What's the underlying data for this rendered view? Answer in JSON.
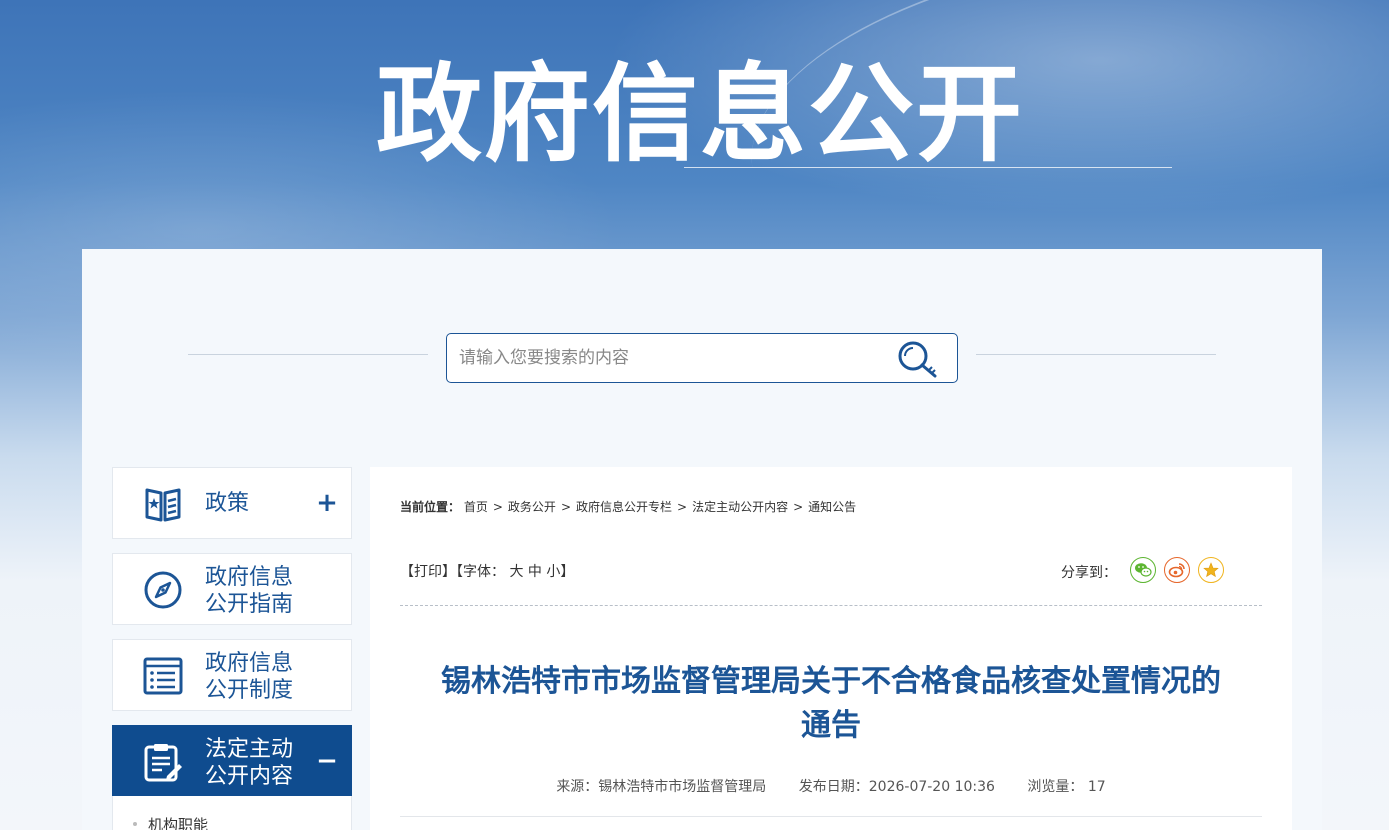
{
  "header": {
    "title": "政府信息公开"
  },
  "search": {
    "placeholder": "请输入您要搜索的内容"
  },
  "sidebar": {
    "items": [
      {
        "line1": "政策",
        "line2": "",
        "toggle": "+"
      },
      {
        "line1": "政府信息",
        "line2": "公开指南",
        "toggle": ""
      },
      {
        "line1": "政府信息",
        "line2": "公开制度",
        "toggle": ""
      },
      {
        "line1": "法定主动",
        "line2": "公开内容",
        "toggle": "−"
      }
    ],
    "sub_items": [
      "机构职能"
    ]
  },
  "breadcrumb": {
    "label": "当前位置：",
    "items": [
      "首页",
      "政务公开",
      "政府信息公开专栏",
      "法定主动公开内容",
      "通知公告"
    ],
    "separator": ">"
  },
  "toolbar": {
    "print": "【打印】",
    "font_open": "【字体：",
    "font_large": "大",
    "font_medium": "中",
    "font_small": "小",
    "font_close": "】",
    "share_label": "分享到："
  },
  "article": {
    "title_line1": "锡林浩特市市场监督管理局关于不合格食品核查处置情况的",
    "title_line2": "通告",
    "source": "来源：锡林浩特市市场监督管理局",
    "date": "发布日期：2026-07-20 10:36",
    "views_label": "浏览量：",
    "views": "17"
  },
  "colors": {
    "primary": "#1c5596",
    "active_bg": "#0f4c8f",
    "wechat": "#5cb531",
    "weibo": "#e6662a",
    "favorite": "#f0b41e"
  }
}
